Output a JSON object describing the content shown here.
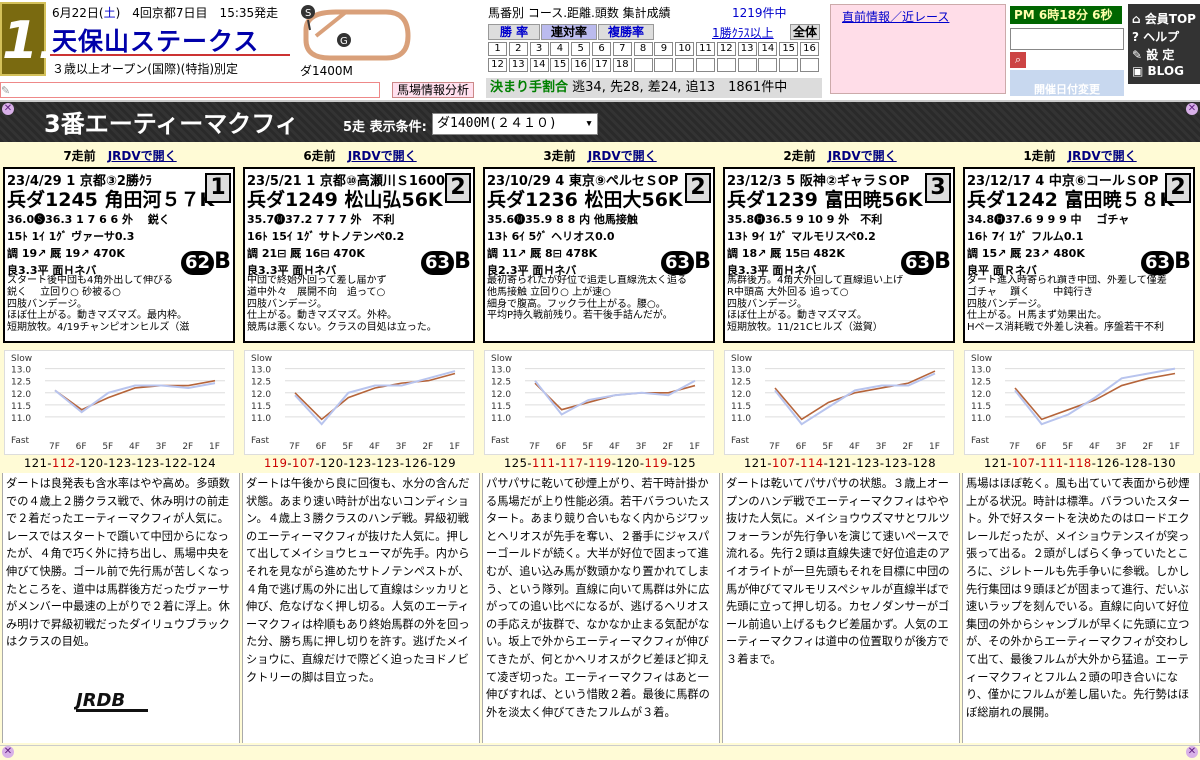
{
  "header": {
    "race_no": "11",
    "date_prefix": "6月22日(",
    "date_day": "土",
    "date_suffix": ")　4回京都7日目　15:35発走",
    "race_name": "天保山ステークス",
    "race_cond": "３歳以上オープン(国際)(特指)別定",
    "course_label": "ダ1400M",
    "summary_title": "馬番別 コース.距離.頭数 集計成績",
    "summary_count": "1219件中",
    "tabs": {
      "win": "勝 率",
      "ren": "連対率",
      "fuku": "複勝率",
      "first_class": "1勝ｸﾗｽ以上",
      "all": "全体"
    },
    "grid_row1": [
      "1",
      "2",
      "3",
      "4",
      "5",
      "6",
      "7",
      "8",
      "9",
      "10",
      "11",
      "12",
      "13",
      "14",
      "15",
      "16"
    ],
    "grid_row2": [
      "12",
      "13",
      "14",
      "15",
      "16",
      "17",
      "18"
    ],
    "decide_label": "決まり手割合",
    "decide_text": "逃34, 先28, 差24, 追13　1861件中",
    "news_title": "直前情報／近レース",
    "clock": "PM 6時18分 6秒",
    "search_icon": "magnifier-icon",
    "date_change": "開催日付変更",
    "menu": [
      "会員TOP",
      "ヘルプ",
      "設 定",
      "BLOG"
    ],
    "baba_analysis": "馬場情報分析"
  },
  "title_bar": {
    "horse": "3番エーティーマクフィ",
    "filter_label": "5走 表示条件:",
    "filter_value": "ダ1400M(２４１０)"
  },
  "y_axis": {
    "slow": "Slow",
    "fast": "Fast",
    "ticks": [
      "13.0",
      "12.5",
      "12.0",
      "11.5",
      "11.0"
    ]
  },
  "x_axis": [
    "7F",
    "6F",
    "5F",
    "4F",
    "3F",
    "2F",
    "1F"
  ],
  "logo_text": "JRDB",
  "runs": [
    {
      "head_prefix": "7走前",
      "head_link": "JRDVで開く",
      "race_line": "23/4/29 1 京都③2勝ｸﾗ",
      "time_line": "兵ダ1245 角田河５７K",
      "frame": "1",
      "l3": "36.0🅢36.3 1 7 6 6 外　 鋭く",
      "l4": "15ﾄ 1ｲ 1ｸﾞ ヴァーサ0.3",
      "l5": "調 19↗ 厩 19↗ 470K",
      "l6": "良3.3平 面Ｈネバ",
      "score": "62",
      "grade": "B",
      "comment": [
        "スタート後中団も4角外出して伸びる",
        "鋭く　 立回り○ 砂被る○",
        "四肢バンデージ。",
        "ほぼ仕上がる。動きマズマズ。最内枠。",
        "短期放牧。4/19チャンピオンヒルズ（滋"
      ],
      "laps": [
        "121",
        "112",
        "120",
        "123",
        "123",
        "122",
        "124"
      ],
      "laps_red": [
        1
      ],
      "chart_data": {
        "type": "line",
        "x": [
          "7F",
          "6F",
          "5F",
          "4F",
          "3F",
          "2F",
          "1F"
        ],
        "series": [
          {
            "values": [
              12.1,
              11.2,
              12.0,
              12.3,
              12.3,
              12.2,
              12.4
            ]
          },
          {
            "values": [
              12.1,
              11.3,
              11.8,
              12.2,
              12.3,
              12.3,
              12.5
            ]
          }
        ],
        "ylim": [
          10.5,
          13.4
        ]
      },
      "detail": "ダートは良発表も含水率はやや高め。多頭数での４歳上２勝クラス戦で、休み明けの前走で２着だったエーティーマクフィが人気に。レースではスタートで躓いて中団からになったが、４角で巧く外に持ち出し、馬場中央を伸びて快勝。ゴール前で先行馬が苦しくなったところを、道中は馬群後方だったヴァーサがメンバー中最速の上がりで２着に浮上。休み明けで昇級初戦だったダイリュウブラックはクラスの目処。"
    },
    {
      "head_prefix": "6走前",
      "head_link": "JRDVで開く",
      "race_line": "23/5/21 1 京都⑩高瀬川Ｓ1600",
      "time_line": "兵ダ1249 松山弘56K",
      "frame": "2",
      "l3": "35.7🅜37.2 7 7 7 外　不利",
      "l4": "16ﾄ 15ｲ 1ｸﾞ サトノテンペ0.2",
      "l5": "調 21⊟ 厩 16⊟ 470K",
      "l6": "良3.3平 面Ｈネバ",
      "score": "63",
      "grade": "B",
      "comment": [
        "中団で終始外回って差し届かず",
        "道中外々　展開不向　追って○",
        "四肢バンデージ。",
        "仕上がる。動きマズマズ。外枠。",
        "競馬は悪くない。クラスの目処は立った。"
      ],
      "laps": [
        "119",
        "107",
        "120",
        "123",
        "123",
        "126",
        "129"
      ],
      "laps_red": [
        0,
        1
      ],
      "chart_data": {
        "type": "line",
        "x": [
          "7F",
          "6F",
          "5F",
          "4F",
          "3F",
          "2F",
          "1F"
        ],
        "series": [
          {
            "values": [
              11.9,
              10.7,
              12.0,
              12.3,
              12.3,
              12.6,
              12.9
            ]
          },
          {
            "values": [
              12.0,
              10.9,
              11.8,
              12.2,
              12.4,
              12.5,
              12.8
            ]
          }
        ],
        "ylim": [
          10.5,
          13.4
        ]
      },
      "detail": "ダートは午後から良に回復も、水分の含んだ状態。あまり速い時計が出ないコンディション。４歳上３勝クラスのハンデ戦。昇級初戦のエーティーマクフィが抜けた人気に。押して出してメイショウヒューマが先手。内からそれを見ながら進めたサトノテンペストが、４角で逃げ馬の外に出して直線はシッカリと伸び、危なげなく押し切る。人気のエーティーマクフィは枠順もあり終始馬群の外を回った分、勝ち馬に押し切りを許す。逃げたメイショウに、直線だけで際どく迫ったヨドノビクトリーの脚は目立った。"
    },
    {
      "head_prefix": "3走前",
      "head_link": "JRDVで開く",
      "race_line": "23/10/29 4 東京⑨ペルセＳOP",
      "time_line": "兵ダ1236 松田大56K",
      "frame": "2",
      "l3": "35.6🅜35.9 8 8 内 他馬接触",
      "l4": "13ﾄ 6ｲ 5ｸﾞ ヘリオス0.0",
      "l5": "調 11↗ 厩 8⊟ 478K",
      "l6": "良2.3平 面Ｈネバ",
      "score": "63",
      "grade": "B",
      "comment": [
        "最初寄られたが好位で追走し直線洗太く追る",
        "他馬接触 立回り○ 上が速○",
        "細身で腹高。フックラ仕上がる。腰○。",
        "平均P持久戦前残り。若干後手詰んだが。"
      ],
      "laps": [
        "125",
        "111",
        "117",
        "119",
        "120",
        "119",
        "125"
      ],
      "laps_red": [
        1,
        2,
        3,
        5
      ],
      "chart_data": {
        "type": "line",
        "x": [
          "7F",
          "6F",
          "5F",
          "4F",
          "3F",
          "2F",
          "1F"
        ],
        "series": [
          {
            "values": [
              12.5,
              11.1,
              11.7,
              11.9,
              12.0,
              11.9,
              12.5
            ]
          },
          {
            "values": [
              12.4,
              11.3,
              11.6,
              11.9,
              12.0,
              12.0,
              12.3
            ]
          }
        ],
        "ylim": [
          10.5,
          13.4
        ]
      },
      "detail": "パサパサに乾いて砂煙上がり、若干時計掛かる馬場だが上り性能必須。若干バラついたスタート。あまり競り合いもなく内からジワッとヘリオスが先手を奪い、２番手にジャスパーゴールドが続く。大半が好位で固まって進むが、追い込み馬が数頭かなり置かれてしまう、という隊列。直線に向いて馬群は外に広がっての追い比べになるが、逃げるヘリオスの手応えが抜群で、なかなか止まる気配がない。坂上で外からエーティーマクフィが伸びてきたが、何とかヘリオスがクビ差ほど抑えて凌ぎ切った。エーティーマクフィはあと一伸びすれば、という惜敗２着。最後に馬群の外を淡太く伸びてきたフルムが３着。"
    },
    {
      "head_prefix": "2走前",
      "head_link": "JRDVで開く",
      "race_line": "23/12/3 5 阪神②ギャラＳOP",
      "time_line": "兵ダ1239 富田暁56K",
      "frame": "3",
      "l3": "35.8🅗36.5 9 10 9 外　不利",
      "l4": "13ﾄ 9ｲ 1ｸﾞ マルモリスペ0.2",
      "l5": "調 18↗ 厩 15⊟ 482K",
      "l6": "良3.3平 面Ｈネバ",
      "score": "63",
      "grade": "B",
      "comment": [
        "馬群後方。4角大外回して直線追い上げ",
        "R中頭高 大外回る 追って○",
        "四肢バンデージ。",
        "ほぼ仕上がる。動きマズマズ。",
        "短期放牧。11/21Cヒルズ（滋賀）"
      ],
      "laps": [
        "121",
        "107",
        "114",
        "121",
        "123",
        "123",
        "128"
      ],
      "laps_red": [
        1,
        2
      ],
      "chart_data": {
        "type": "line",
        "x": [
          "7F",
          "6F",
          "5F",
          "4F",
          "3F",
          "2F",
          "1F"
        ],
        "series": [
          {
            "values": [
              12.1,
              10.7,
              11.4,
              12.1,
              12.3,
              12.3,
              12.8
            ]
          },
          {
            "values": [
              12.2,
              10.9,
              11.6,
              12.0,
              12.2,
              12.4,
              12.9
            ]
          }
        ],
        "ylim": [
          10.5,
          13.4
        ]
      },
      "detail": "ダートは乾いてパサパサの状態。３歳上オープンのハンデ戦でエーティーマクフィはやや抜けた人気に。メイショウウズマサとワルツフォーランが先行争いを演じて速いペースで流れる。先行２頭は直線失速で好位追走のアイオライトが一旦先頭もそれを目標に中団の馬が伸びてマルモリスペシャルが直線半ばで先頭に立って押し切る。カセノダンサーがゴール前追い上げるもクビ差届かず。人気のエーティーマクフィは道中の位置取りが後方で３着まで。"
    },
    {
      "head_prefix": "1走前",
      "head_link": "JRDVで開く",
      "race_line": "23/12/17 4 中京⑥コールＳOP",
      "time_line": "兵ダ1242 富田暁５８K",
      "frame": "2",
      "l3": "34.8🅗37.6 9 9 9 中　 ゴチャ",
      "l4": "16ﾄ 7ｲ 1ｸﾞ フルム0.1",
      "l5": "調 15↗ 厩 23↗ 480K",
      "l6": "良平 面Ｒネバ",
      "score": "63",
      "grade": "B",
      "comment": [
        "ダート進入時寄られ躓き中団、外差して僅差",
        "ゴチャ　 躓く　　 中鈍行き",
        "四肢バンデージ。",
        "仕上がる。Ｈ馬まず効果出た。",
        "Hペース消耗戦で外差し決着。序盤若干不利"
      ],
      "laps": [
        "121",
        "107",
        "111",
        "118",
        "126",
        "128",
        "130"
      ],
      "laps_red": [
        1,
        2,
        3
      ],
      "chart_data": {
        "type": "line",
        "x": [
          "7F",
          "6F",
          "5F",
          "4F",
          "3F",
          "2F",
          "1F"
        ],
        "series": [
          {
            "values": [
              12.1,
              10.7,
              11.1,
              11.8,
              12.6,
              12.8,
              13.0
            ]
          },
          {
            "values": [
              12.2,
              10.9,
              11.3,
              11.7,
              12.3,
              12.6,
              12.8
            ]
          }
        ],
        "ylim": [
          10.5,
          13.4
        ]
      },
      "detail": "馬場はほぼ乾く。風も出ていて表面から砂煙上がる状況。時計は標準。バラついたスタート。外で好スタートを決めたのはロードエクレールだったが、メイショウテンスイが突っ張って出る。２頭がしばらく争っていたところに、ジレトールも先手争いに参戦。しかし先行集団は９頭ほどが固まって進行、だいぶ速いラップを刻んでいる。直線に向いて好位集団の外からシャンブルが早くに先頭に立つが、その外からエーティーマクフィが交わして出て、最後フルムが大外から猛追。エーティーマクフィとフルム２頭の叩き合いになり、僅かにフルムが差し届いた。先行勢はほぼ総崩れの展開。"
    }
  ]
}
